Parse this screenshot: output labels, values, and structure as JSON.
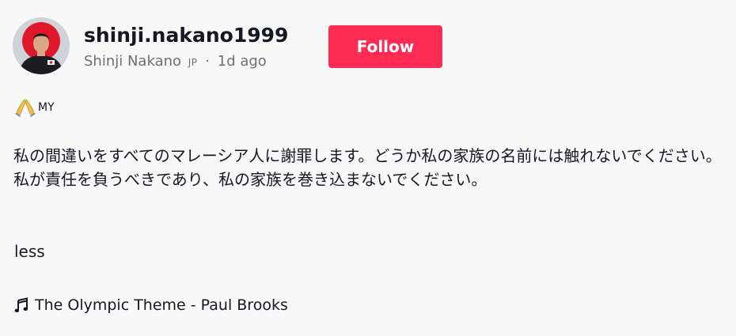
{
  "post": {
    "username": "shinji.nakano1999",
    "display_name": "Shinji Nakano",
    "region": "JP",
    "separator": "·",
    "time_ago": "1d ago",
    "follow_label": "Follow",
    "tag_emoji_icon": "folded-hands-icon",
    "tag_text": "MY",
    "caption": "私の間違いをすべてのマレーシア人に謝罪します。どうか私の家族の名前には触れないでください。私が責任を負うべきであり、私の家族を巻き込まないでください。",
    "less_label": "less",
    "music_icon": "music-note-icon",
    "music_title": "The Olympic Theme - Paul Brooks"
  },
  "colors": {
    "accent": "#fe2c55",
    "text": "#161823",
    "muted": "#6e6f75",
    "background": "#f8f8f8"
  }
}
